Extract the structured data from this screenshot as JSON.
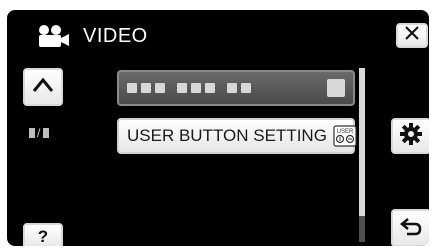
{
  "header": {
    "title": "VIDEO",
    "icon": "video-camera-icon"
  },
  "buttons": {
    "close": "close-icon",
    "up": "chevron-up-icon",
    "settings": "gear-icon",
    "help_label": "?",
    "back": "back-arrow-icon"
  },
  "page_indicator": {
    "separator": "/"
  },
  "menu": {
    "items": [
      {
        "label": "",
        "masked": true,
        "selected": false
      },
      {
        "label": "USER BUTTON SETTING",
        "masked": false,
        "icon": "user-button-icon"
      }
    ]
  },
  "colors": {
    "background": "#000000",
    "button_face": "#f2f2f2",
    "selected_item": "#5a5a5a"
  }
}
